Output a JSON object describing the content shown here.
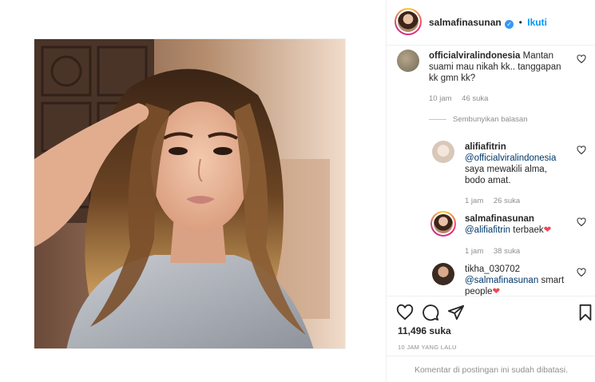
{
  "post": {
    "author": {
      "username": "salmafinasunan",
      "verified_icon": "verified-badge-icon",
      "dot": "•",
      "follow_label": "Ikuti"
    }
  },
  "comments": [
    {
      "username": "officialviralindonesia",
      "text": "Mantan suami mau nikah kk.. tanggapan kk gmn kk?",
      "time": "10 jam",
      "likes": "46 suka"
    }
  ],
  "replies_toggle": "Sembunyikan balasan",
  "replies": [
    {
      "username": "alifiafitrin",
      "mention": "@officialviralindonesia",
      "text": "saya mewakili alma, bodo amat.",
      "time": "1 jam",
      "likes": "26 suka"
    },
    {
      "username": "salmafinasunan",
      "mention": "@alifiafitrin",
      "text": "terbaek",
      "emoji": "❤",
      "time": "1 jam",
      "likes": "38 suka"
    },
    {
      "username": "tikha_030702",
      "mention": "@salmafinasunan",
      "text": "smart people",
      "emoji": "❤"
    }
  ],
  "footer": {
    "likes": "11,496 suka",
    "timestamp": "10 JAM YANG LALU",
    "comments_disabled": "Komentar di postingan ini sudah dibatasi."
  },
  "colors": {
    "link_blue": "#0095f6",
    "mention": "#00376b",
    "heart_red": "#ed4956",
    "muted": "#8e8e8e"
  }
}
